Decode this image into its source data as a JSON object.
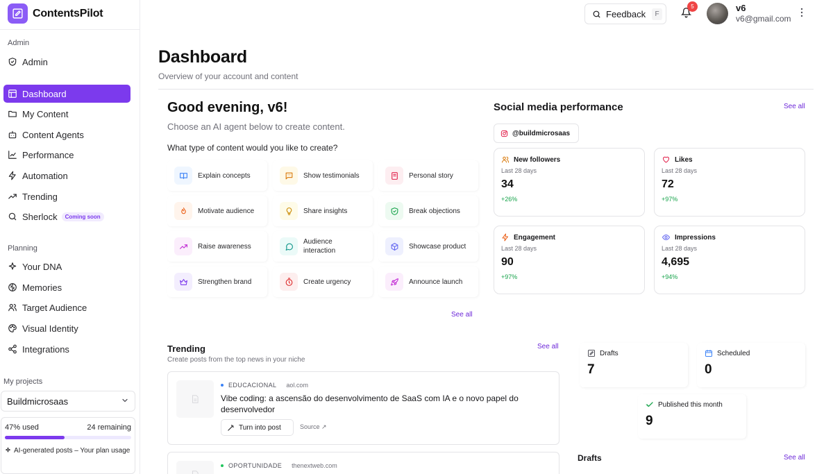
{
  "brand": {
    "name": "ContentsPilot"
  },
  "sidebar": {
    "admin_section": "Admin",
    "admin_items": [
      {
        "label": "Admin",
        "icon": "shield-icon"
      }
    ],
    "main_items": [
      {
        "label": "Dashboard",
        "icon": "dashboard-icon",
        "active": true
      },
      {
        "label": "My Content",
        "icon": "folder-icon"
      },
      {
        "label": "Content Agents",
        "icon": "bot-icon"
      },
      {
        "label": "Performance",
        "icon": "chart-icon"
      },
      {
        "label": "Automation",
        "icon": "zap-icon"
      },
      {
        "label": "Trending",
        "icon": "trending-icon"
      },
      {
        "label": "Sherlock",
        "icon": "search-icon",
        "badge": "Coming soon"
      }
    ],
    "planning_section": "Planning",
    "planning_items": [
      {
        "label": "Your DNA",
        "icon": "sparkles-icon"
      },
      {
        "label": "Memories",
        "icon": "brain-icon"
      },
      {
        "label": "Target Audience",
        "icon": "users-icon"
      },
      {
        "label": "Visual Identity",
        "icon": "palette-icon"
      },
      {
        "label": "Integrations",
        "icon": "share-icon"
      }
    ],
    "projects_label": "My projects",
    "project_selected": "Buildmicrosaas",
    "usage": {
      "used_label": "47% used",
      "remaining_label": "24 remaining",
      "used_fraction": 0.47,
      "note": "AI-generated posts – Your plan usage"
    }
  },
  "topbar": {
    "feedback_label": "Feedback",
    "feedback_shortcut": "F",
    "notification_count": "5",
    "user_name": "v6",
    "user_email": "v6@gmail.com"
  },
  "page": {
    "title": "Dashboard",
    "subtitle": "Overview of your account and content"
  },
  "greeting": {
    "title": "Good evening, v6!",
    "subtitle": "Choose an AI agent below to create content.",
    "question": "What type of content would you like to create?",
    "see_all": "See all"
  },
  "content_types": [
    {
      "label": "Explain concepts",
      "icon": "book-icon",
      "color": "#3b82f6",
      "bg": "#eff6ff"
    },
    {
      "label": "Show testimonials",
      "icon": "message-quote-icon",
      "color": "#d97706",
      "bg": "#fef9e7"
    },
    {
      "label": "Personal story",
      "icon": "notebook-icon",
      "color": "#e11d48",
      "bg": "#fdeef1"
    },
    {
      "label": "Motivate audience",
      "icon": "flame-icon",
      "color": "#ea580c",
      "bg": "#fff4ec"
    },
    {
      "label": "Share insights",
      "icon": "lightbulb-icon",
      "color": "#ca8a04",
      "bg": "#fefbe8"
    },
    {
      "label": "Break objections",
      "icon": "shield-check-icon",
      "color": "#16a34a",
      "bg": "#edfaf1"
    },
    {
      "label": "Raise awareness",
      "icon": "trend-up-icon",
      "color": "#c026d3",
      "bg": "#fbeefc"
    },
    {
      "label": "Audience interaction",
      "icon": "chat-icon",
      "color": "#0d9488",
      "bg": "#ebfaf8"
    },
    {
      "label": "Showcase product",
      "icon": "box-icon",
      "color": "#6366f1",
      "bg": "#eef0fe"
    },
    {
      "label": "Strengthen brand",
      "icon": "crown-icon",
      "color": "#7c3aed",
      "bg": "#f3eefe"
    },
    {
      "label": "Create urgency",
      "icon": "timer-icon",
      "color": "#dc2626",
      "bg": "#fdeeee"
    },
    {
      "label": "Announce launch",
      "icon": "rocket-icon",
      "color": "#c026d3",
      "bg": "#fbeefc"
    }
  ],
  "social": {
    "title": "Social media performance",
    "see_all": "See all",
    "handle": "@buildmicrosaas",
    "stats": [
      {
        "label": "New followers",
        "period": "Last 28 days",
        "value": "34",
        "delta": "+26%",
        "icon": "users-icon",
        "color": "#d97706"
      },
      {
        "label": "Likes",
        "period": "Last 28 days",
        "value": "72",
        "delta": "+97%",
        "icon": "heart-icon",
        "color": "#e11d48"
      },
      {
        "label": "Engagement",
        "period": "Last 28 days",
        "value": "90",
        "delta": "+97%",
        "icon": "zap-icon",
        "color": "#ea580c"
      },
      {
        "label": "Impressions",
        "period": "Last 28 days",
        "value": "4,695",
        "delta": "+94%",
        "icon": "eye-icon",
        "color": "#6366f1"
      }
    ]
  },
  "trending": {
    "title": "Trending",
    "subtitle": "Create posts from the top news in your niche",
    "see_all": "See all",
    "items": [
      {
        "category": "EDUCACIONAL",
        "source": "aol.com",
        "title": "Vibe coding: a ascensão do desenvolvimento de SaaS com IA e o novo papel do desenvolvedor",
        "button": "Turn into post",
        "link": "Source ↗",
        "dot": "#3b82f6"
      },
      {
        "category": "OPORTUNIDADE",
        "source": "thenextweb.com",
        "dot": "#22c55e"
      }
    ]
  },
  "post_stats": [
    {
      "label": "Drafts",
      "value": "7",
      "icon": "edit-icon"
    },
    {
      "label": "Scheduled",
      "value": "0",
      "icon": "calendar-icon"
    },
    {
      "label": "Published this month",
      "value": "9",
      "icon": "check-icon"
    }
  ],
  "drafts": {
    "title": "Drafts",
    "see_all": "See all"
  }
}
